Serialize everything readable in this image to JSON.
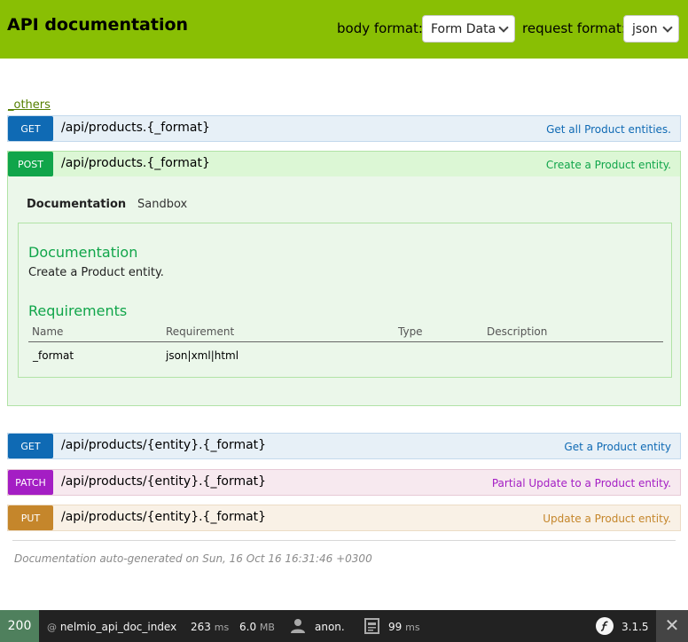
{
  "header": {
    "title": "API documentation",
    "body_format_label": "body format:",
    "body_format_value": "Form Data",
    "request_format_label": "request format:",
    "request_format_value": "json"
  },
  "section": {
    "link": "_others"
  },
  "endpoints": [
    {
      "method": "GET",
      "path": "/api/products.{_format}",
      "description": "Get all Product entities."
    },
    {
      "method": "POST",
      "path": "/api/products.{_format}",
      "description": "Create a Product entity."
    },
    {
      "method": "GET",
      "path": "/api/products/{entity}.{_format}",
      "description": "Get a Product entity"
    },
    {
      "method": "PATCH",
      "path": "/api/products/{entity}.{_format}",
      "description": "Partial Update to a Product entity."
    },
    {
      "method": "PUT",
      "path": "/api/products/{entity}.{_format}",
      "description": "Update a Product entity."
    }
  ],
  "panel": {
    "tabs": [
      "Documentation",
      "Sandbox"
    ],
    "doc_heading": "Documentation",
    "doc_text": "Create a Product entity.",
    "req_heading": "Requirements",
    "columns": [
      "Name",
      "Requirement",
      "Type",
      "Description"
    ],
    "rows": [
      {
        "name": "_format",
        "requirement": "json|xml|html",
        "type": "",
        "description": ""
      }
    ]
  },
  "footer": {
    "note": "Documentation auto-generated on Sun, 16 Oct 16 16:31:46 +0300"
  },
  "toolbar": {
    "status": "200",
    "route_prefix": "@",
    "route": "nelmio_api_doc_index",
    "time_value": "263",
    "time_unit": "ms",
    "memory_value": "6.0",
    "memory_unit": "MB",
    "user": "anon.",
    "db_value": "99",
    "db_unit": "ms",
    "version": "3.1.5",
    "close": "✕"
  },
  "colors": {
    "header_bg": "#89bf04",
    "get": "#0f6ab4",
    "post": "#10a54a",
    "patch": "#a41ec4",
    "put": "#c5862b",
    "status_ok": "#4f805d"
  },
  "icons": [
    "chevron-down-icon",
    "user-icon",
    "document-icon",
    "symfony-logo-icon",
    "close-icon"
  ]
}
